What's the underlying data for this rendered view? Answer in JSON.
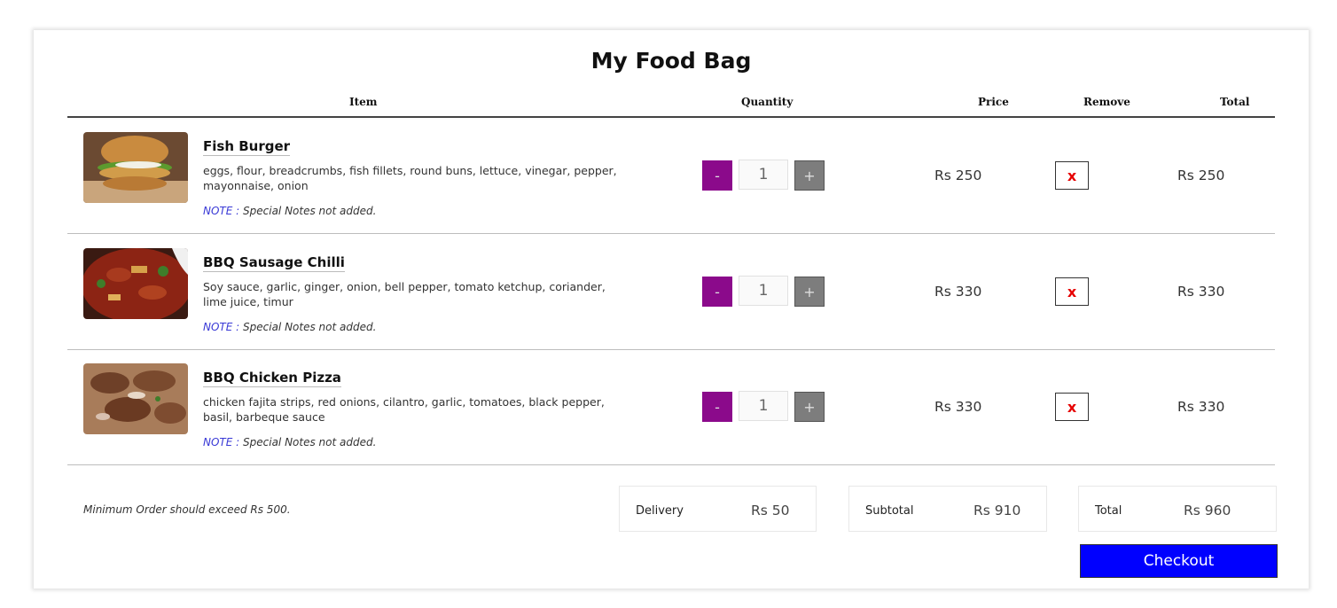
{
  "page": {
    "title": "My Food Bag"
  },
  "table": {
    "headers": {
      "item": "Item",
      "quantity": "Quantity",
      "price": "Price",
      "remove": "Remove",
      "total": "Total"
    }
  },
  "items": [
    {
      "name": "Fish Burger",
      "description": "eggs, flour, breadcrumbs, fish fillets, round buns, lettuce, vinegar, pepper, mayonnaise, onion",
      "note_label": "NOTE :",
      "note_text": " Special Notes not added.",
      "quantity": "1",
      "price": "Rs 250",
      "total": "Rs 250",
      "minus_label": "-",
      "plus_label": "+",
      "remove_label": "x"
    },
    {
      "name": "BBQ Sausage Chilli",
      "description": "Soy sauce, garlic, ginger, onion, bell pepper, tomato ketchup, coriander, lime juice, timur",
      "note_label": "NOTE :",
      "note_text": " Special Notes not added.",
      "quantity": "1",
      "price": "Rs 330",
      "total": "Rs 330",
      "minus_label": "-",
      "plus_label": "+",
      "remove_label": "x"
    },
    {
      "name": "BBQ Chicken Pizza",
      "description": "chicken fajita strips, red onions, cilantro, garlic, tomatoes, black pepper, basil, barbeque sauce",
      "note_label": "NOTE :",
      "note_text": " Special Notes not added.",
      "quantity": "1",
      "price": "Rs 330",
      "total": "Rs 330",
      "minus_label": "-",
      "plus_label": "+",
      "remove_label": "x"
    }
  ],
  "summary": {
    "min_order_text": "Minimum Order should exceed Rs 500.",
    "delivery_label": "Delivery",
    "delivery_value": "Rs 50",
    "subtotal_label": "Subtotal",
    "subtotal_value": "Rs 910",
    "total_label": "Total",
    "total_value": "Rs 960"
  },
  "checkout_label": "Checkout",
  "colors": {
    "minus_button": "#8b0a8b",
    "plus_button": "#7d7d7d",
    "remove_x": "#e60000",
    "note_label": "#3a3ad6",
    "checkout_button": "#0000ff"
  }
}
